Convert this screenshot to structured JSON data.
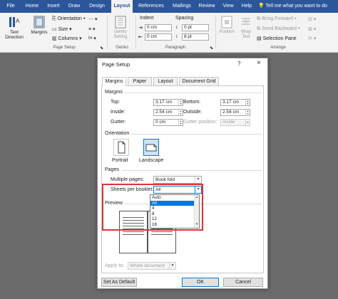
{
  "ribbon_tabs": [
    "File",
    "Home",
    "Insert",
    "Draw",
    "Design",
    "Layout",
    "References",
    "Mailings",
    "Review",
    "View",
    "Help"
  ],
  "tell_me": "Tell me what you want to do",
  "ribbon": {
    "text_direction": "Text Direction",
    "margins": "Margins",
    "orientation": "Orientation",
    "size": "Size",
    "columns": "Columns",
    "page_setup_group": "Page Setup",
    "genko": "Genko Setting",
    "genko_group": "Genko",
    "indent": "Indent",
    "spacing": "Spacing",
    "indent_left": "0 cm",
    "indent_right": "0 cm",
    "spacing_before": "0 pt",
    "spacing_after": "8 pt",
    "paragraph_group": "Paragraph",
    "position": "Position",
    "wrap_text": "Wrap Text",
    "bring_forward": "Bring Forward",
    "send_backward": "Send Backward",
    "selection_pane": "Selection Pane",
    "arrange_group": "Arrange"
  },
  "dialog": {
    "title": "Page Setup",
    "help": "?",
    "close": "×",
    "tabs": [
      "Margins",
      "Paper",
      "Layout",
      "Document Grid"
    ],
    "margins_section": "Margins",
    "top_label": "Top:",
    "top_value": "3.17 cm",
    "bottom_label": "Bottom:",
    "bottom_value": "3.17 cm",
    "inside_label": "Inside:",
    "inside_value": "2.54 cm",
    "outside_label": "Outside:",
    "outside_value": "2.54 cm",
    "gutter_label": "Gutter:",
    "gutter_value": "0 cm",
    "gutter_position_label": "Gutter position:",
    "gutter_position_value": "Inside",
    "orientation_section": "Orientation",
    "portrait": "Portrait",
    "landscape": "Landscape",
    "pages_section": "Pages",
    "multiple_pages_label": "Multiple pages:",
    "multiple_pages_value": "Book fold",
    "sheets_label": "Sheets per booklet:",
    "sheets_value": "All",
    "sheets_options": [
      "Auto",
      "All",
      "4",
      "8",
      "12",
      "16"
    ],
    "sheets_selected_index": 1,
    "preview_section": "Preview",
    "apply_to_label": "Apply to:",
    "apply_to_value": "Whole document",
    "set_default": "Set As Default",
    "ok": "OK",
    "cancel": "Cancel"
  },
  "colors": {
    "ribbon_blue": "#2b579a",
    "highlight": "#e0323a",
    "accent": "#0078d7"
  }
}
